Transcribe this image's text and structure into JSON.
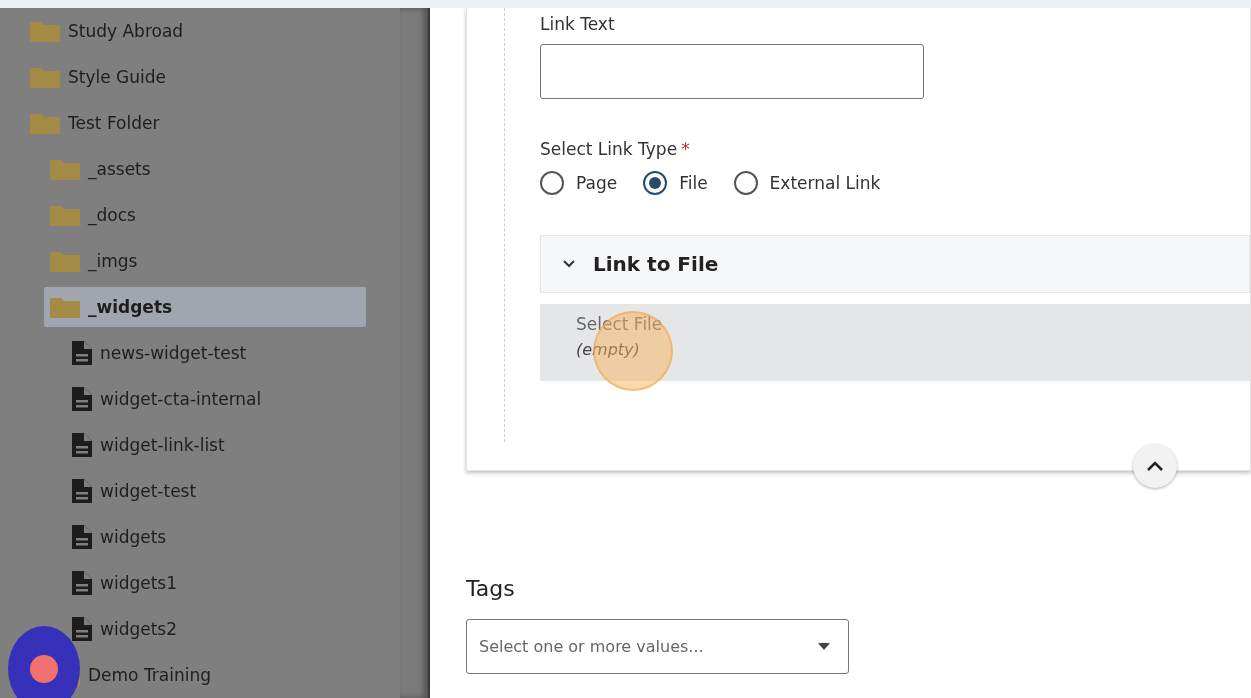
{
  "tree": [
    {
      "label": "Study Abroad",
      "kind": "folder",
      "selected": false
    },
    {
      "label": "Style Guide",
      "kind": "folder",
      "selected": false
    },
    {
      "label": "Test Folder",
      "kind": "folder",
      "selected": false,
      "children": [
        {
          "label": "_assets",
          "kind": "folder",
          "selected": false
        },
        {
          "label": "_docs",
          "kind": "folder",
          "selected": false
        },
        {
          "label": "_imgs",
          "kind": "folder",
          "selected": false
        },
        {
          "label": "_widgets",
          "kind": "folder",
          "selected": true,
          "children": [
            {
              "label": "news-widget-test",
              "kind": "file",
              "selected": false
            },
            {
              "label": "widget-cta-internal",
              "kind": "file",
              "selected": false
            },
            {
              "label": "widget-link-list",
              "kind": "file",
              "selected": false
            },
            {
              "label": "widget-test",
              "kind": "file",
              "selected": false
            },
            {
              "label": "widgets",
              "kind": "file",
              "selected": false
            },
            {
              "label": "widgets1",
              "kind": "file",
              "selected": false
            },
            {
              "label": "widgets2",
              "kind": "file",
              "selected": false
            }
          ]
        },
        {
          "label": "Demo Training",
          "kind": "folder",
          "selected": false
        }
      ]
    }
  ],
  "form": {
    "link_text": {
      "label": "Link Text"
    },
    "link_type": {
      "label": "Select Link Type",
      "required_mark": "*",
      "options": [
        {
          "label": "Page",
          "selected": false
        },
        {
          "label": "File",
          "selected": true
        },
        {
          "label": "External Link",
          "selected": false
        }
      ]
    },
    "section": {
      "title": "Link to File",
      "expanded": true,
      "field_label": "Select File",
      "field_value": "(empty)"
    }
  },
  "tags": {
    "label": "Tags",
    "placeholder": "Select one or more values..."
  }
}
